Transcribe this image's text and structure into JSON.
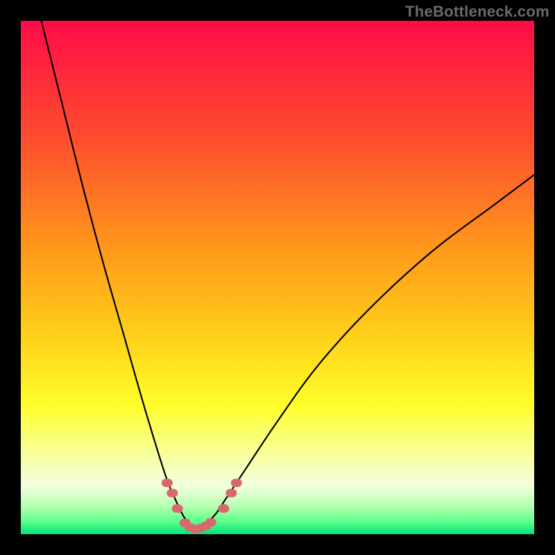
{
  "watermark": "TheBottleneck.com",
  "chart_data": {
    "type": "line",
    "title": "",
    "xlabel": "",
    "ylabel": "",
    "xlim": [
      0,
      100
    ],
    "ylim": [
      0,
      100
    ],
    "grid": false,
    "curve_note": "V-shaped smooth curve with minimum near x≈34; left branch steep, right branch shallower asymptote.",
    "series": [
      {
        "name": "bottleneck-curve",
        "x": [
          4,
          8,
          12,
          16,
          20,
          24,
          28,
          30,
          32,
          34,
          36,
          38,
          40,
          44,
          50,
          58,
          68,
          80,
          92,
          100
        ],
        "y": [
          100,
          84,
          68,
          53,
          39,
          25,
          12,
          7,
          3,
          1,
          2,
          4,
          7,
          13,
          22,
          33,
          44,
          55,
          64,
          70
        ]
      }
    ],
    "markers": {
      "name": "highlighted-points",
      "color": "#d9686e",
      "points_note": "Salmon dots and short dashes forming rounded U at the trough and a couple on each flank.",
      "x": [
        28.5,
        29.5,
        30.5,
        32,
        33,
        34,
        35,
        36,
        37,
        39.5,
        41,
        42
      ],
      "y": [
        10,
        8,
        5,
        2.2,
        1.3,
        1,
        1.2,
        1.6,
        2.3,
        5,
        8,
        10
      ]
    },
    "background_gradient": {
      "stops": [
        {
          "offset": 0.0,
          "color": "#ff0b47"
        },
        {
          "offset": 0.22,
          "color": "#ff4a2f"
        },
        {
          "offset": 0.45,
          "color": "#ff9a1a"
        },
        {
          "offset": 0.62,
          "color": "#ffd21a"
        },
        {
          "offset": 0.75,
          "color": "#ffff2a"
        },
        {
          "offset": 0.86,
          "color": "#f6ffb0"
        },
        {
          "offset": 0.905,
          "color": "#f2ffe0"
        },
        {
          "offset": 0.945,
          "color": "#b8ffb0"
        },
        {
          "offset": 0.975,
          "color": "#5cff8c"
        },
        {
          "offset": 1.0,
          "color": "#00e57a"
        }
      ]
    }
  }
}
